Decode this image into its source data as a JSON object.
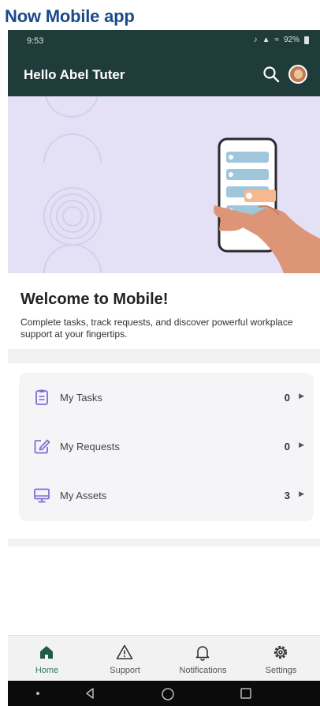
{
  "page_heading": "Now Mobile app",
  "status_bar": {
    "time": "9:53",
    "battery": "92%"
  },
  "app_bar": {
    "title": "Hello Abel Tuter",
    "search_icon": "search-icon",
    "avatar": "avatar"
  },
  "welcome": {
    "title": "Welcome to Mobile!",
    "description": "Complete tasks, track requests, and discover powerful workplace support at your fingertips."
  },
  "list": [
    {
      "label": "My Tasks",
      "count": "0",
      "icon": "clipboard-icon"
    },
    {
      "label": "My Requests",
      "count": "0",
      "icon": "edit-icon"
    },
    {
      "label": "My Assets",
      "count": "3",
      "icon": "monitor-icon"
    }
  ],
  "bottom_nav": [
    {
      "label": "Home",
      "icon": "home-icon",
      "active": true
    },
    {
      "label": "Support",
      "icon": "warning-icon",
      "active": false
    },
    {
      "label": "Notifications",
      "icon": "bell-icon",
      "active": false
    },
    {
      "label": "Settings",
      "icon": "gear-icon",
      "active": false
    }
  ],
  "colors": {
    "app_bar": "#1f3c3a",
    "hero_bg": "#e4e1f7",
    "accent_green": "#2e7d5b",
    "icon_purple": "#7b6fd6"
  }
}
